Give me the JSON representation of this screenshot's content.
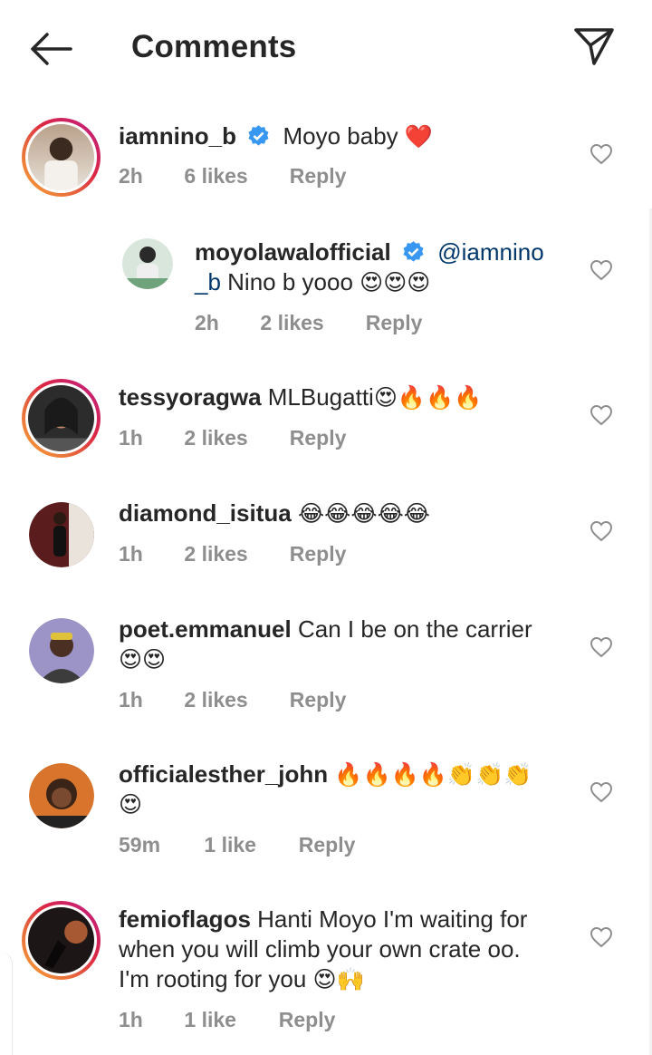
{
  "header": {
    "title": "Comments",
    "back_icon": "arrow-left-icon",
    "send_icon": "paper-plane-icon"
  },
  "colors": {
    "text": "#262626",
    "meta": "#8e8e8e",
    "verified": "#3897f0",
    "mention": "#00376b",
    "heart": "#e0245e"
  },
  "reply_label": "Reply",
  "comments": [
    {
      "username": "iamnino_b",
      "verified": true,
      "text": "Moyo baby",
      "emoji": "❤️",
      "time": "2h",
      "likes": "6 likes"
    },
    {
      "username": "moyolawalofficial",
      "verified": true,
      "mention": "@iamnino_b",
      "mention_line1": "@iamnino",
      "mention_line2": "_b",
      "text": "Nino b yooo",
      "emoji": "😍😍😍",
      "time": "2h",
      "likes": "2 likes"
    },
    {
      "username": "tessyoragwa",
      "text": "MLBugatti",
      "emoji": "😍🔥🔥🔥",
      "time": "1h",
      "likes": "2 likes"
    },
    {
      "username": "diamond_isitua",
      "text": "",
      "emoji": "😂😂😂😂😂",
      "time": "1h",
      "likes": "2 likes"
    },
    {
      "username": "poet.emmanuel",
      "text": "Can I be on the carrier",
      "emoji": "😍😍",
      "time": "1h",
      "likes": "2 likes"
    },
    {
      "username": "officialesther_john",
      "text": "",
      "emoji": "🔥🔥🔥🔥👏👏👏",
      "emoji2": "😍",
      "time": "59m",
      "likes": "1 like"
    },
    {
      "username": "femioflagos",
      "text_line1": "Hanti Moyo I'm waiting for",
      "text_line2": "when you will climb your own crate oo.",
      "text_line3": "I'm rooting for you",
      "emoji": "😍🙌",
      "time": "1h",
      "likes": "1 like"
    }
  ]
}
